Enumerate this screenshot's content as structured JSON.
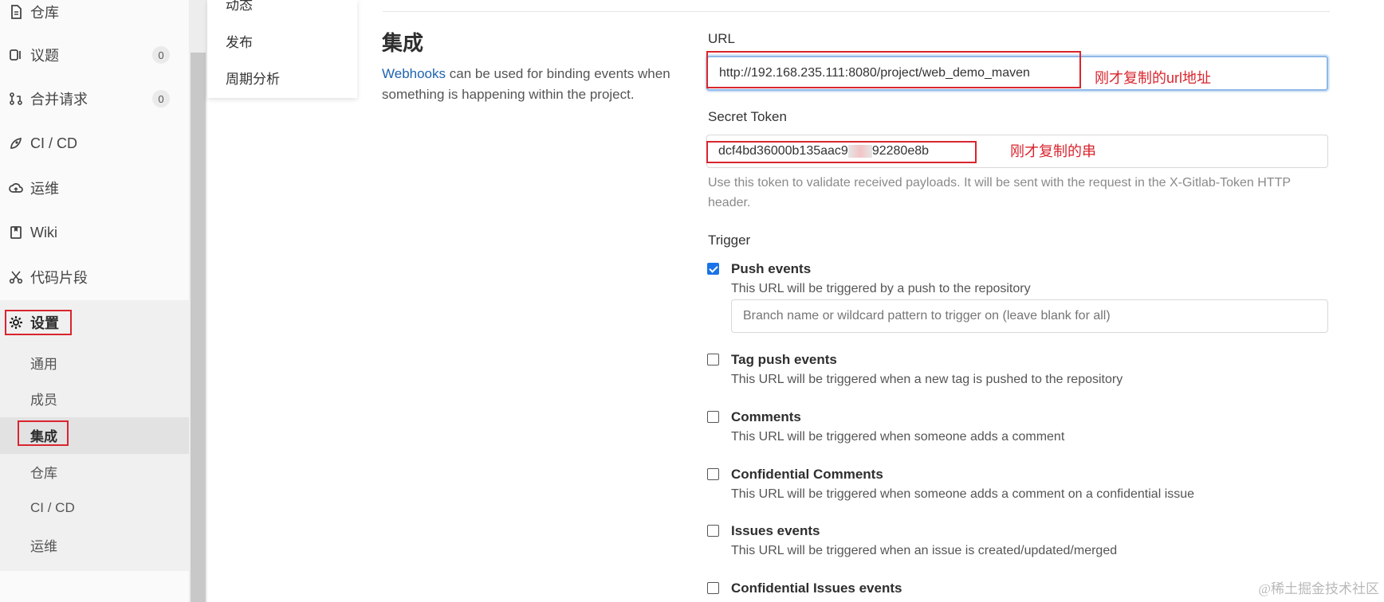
{
  "sidebar": {
    "items": [
      {
        "label": "仓库",
        "icon": "file-icon"
      },
      {
        "label": "议题",
        "icon": "issues-icon",
        "badge": "0"
      },
      {
        "label": "合并请求",
        "icon": "merge-request-icon",
        "badge": "0"
      },
      {
        "label": "CI / CD",
        "icon": "rocket-icon"
      },
      {
        "label": "运维",
        "icon": "cloud-icon"
      },
      {
        "label": "Wiki",
        "icon": "book-icon"
      },
      {
        "label": "代码片段",
        "icon": "scissors-icon"
      }
    ],
    "settings": {
      "label": "设置",
      "icon": "gear-icon",
      "children": [
        "通用",
        "成员",
        "集成",
        "仓库",
        "CI / CD",
        "运维"
      ],
      "active": "集成"
    }
  },
  "submenu": {
    "items": [
      "动态",
      "发布",
      "周期分析"
    ]
  },
  "section": {
    "title": "集成",
    "desc_link": "Webhooks",
    "desc_rest": " can be used for binding events when something is happening within the project."
  },
  "form": {
    "url_label": "URL",
    "url_value": "http://192.168.235.111:8080/project/web_demo_maven",
    "url_annotation": "刚才复制的url地址",
    "token_label": "Secret Token",
    "token_prefix": "dcf4bd36000b135aac9",
    "token_suffix": "92280e8b",
    "token_annotation": "刚才复制的串",
    "token_help": "Use this token to validate received payloads. It will be sent with the request in the X-Gitlab-Token HTTP header.",
    "trigger_label": "Trigger",
    "branch_placeholder": "Branch name or wildcard pattern to trigger on (leave blank for all)",
    "triggers": [
      {
        "title": "Push events",
        "desc": "This URL will be triggered by a push to the repository",
        "checked": true
      },
      {
        "title": "Tag push events",
        "desc": "This URL will be triggered when a new tag is pushed to the repository",
        "checked": false
      },
      {
        "title": "Comments",
        "desc": "This URL will be triggered when someone adds a comment",
        "checked": false
      },
      {
        "title": "Confidential Comments",
        "desc": "This URL will be triggered when someone adds a comment on a confidential issue",
        "checked": false
      },
      {
        "title": "Issues events",
        "desc": "This URL will be triggered when an issue is created/updated/merged",
        "checked": false
      },
      {
        "title": "Confidential Issues events",
        "desc": "",
        "checked": false
      }
    ]
  },
  "colors": {
    "accent_red": "#d9252e",
    "link_blue": "#1f63b0",
    "checkbox_blue": "#1a73e8"
  },
  "watermark": "@稀土掘金技术社区"
}
